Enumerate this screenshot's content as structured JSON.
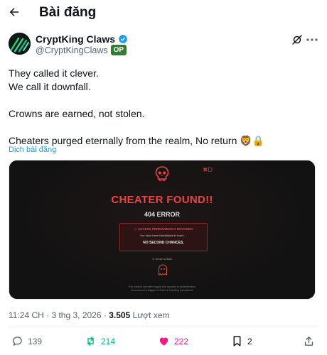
{
  "header": {
    "title": "Bài đăng"
  },
  "author": {
    "name": "CryptKing Claws",
    "handle": "@CryptKingClaws",
    "badge": "OP"
  },
  "post": {
    "lines": [
      "They called it clever.\nWe call it downfall.",
      "Crowns are earned, not stolen.",
      "Cheaters purged eternally from the realm, No return 🦁🔒"
    ],
    "translate_label": "Dịch bài đăng"
  },
  "media": {
    "headline": "CHEATER FOUND!!",
    "code": "404 ERROR",
    "box_title": "⚠ ACCESS PERMANENTLY REVOKED",
    "box_text": "You have been blacklisted at exact …",
    "box_strong": "NO SECOND CHANCES.",
    "details_link": "⊙ Show Details",
    "footer": "This incident has been logged and reported to administrators.\nYour account is flagged in Patrol & Handling Compliance.",
    "corner_mark": "✖D"
  },
  "meta": {
    "time": "11:24 CH · 3 thg 3, 2026 · ",
    "views": "3.505",
    "views_label": " Lượt xem"
  },
  "actions": {
    "replies": "139",
    "reposts": "214",
    "likes": "222",
    "bookmarks": "2"
  },
  "colors": {
    "accent": "#1d9bf0",
    "repost": "#00ba7c",
    "like": "#f91880",
    "danger": "#e84545",
    "op_badge": "#2e7d32"
  }
}
